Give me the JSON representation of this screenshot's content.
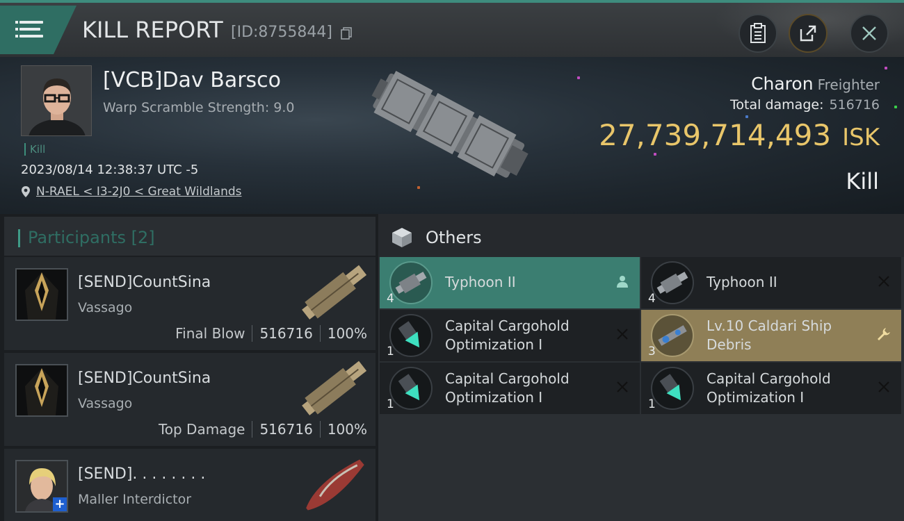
{
  "header": {
    "title": "KILL REPORT",
    "report_id": "[ID:8755844]"
  },
  "victim": {
    "name": "[VCB]Dav Barsco",
    "warp_scramble": "Warp Scramble Strength: 9.0",
    "tag": "Kill",
    "timestamp": "2023/08/14 12:38:37 UTC -5",
    "location": "N-RAEL < I3-2J0 < Great Wildlands",
    "ship_name": "Charon",
    "ship_class": "Freighter",
    "total_damage_label": "Total damage:",
    "total_damage_value": "516716",
    "isk_value": "27,739,714,493",
    "isk_unit": "ISK",
    "result": "Kill"
  },
  "participants": {
    "header": "Participants [2]",
    "rows": [
      {
        "name": "[SEND]CountSina",
        "ship": "Vassago",
        "role": "Final Blow",
        "damage": "516716",
        "percent": "100%"
      },
      {
        "name": "[SEND]CountSina",
        "ship": "Vassago",
        "role": "Top Damage",
        "damage": "516716",
        "percent": "100%"
      },
      {
        "name": "[SEND]. . . . . . . .",
        "ship": "Maller Interdictor"
      }
    ]
  },
  "others": {
    "header": "Others",
    "items": [
      {
        "label": "Typhoon II",
        "qty": "4",
        "state": "selected",
        "mark": "person-icon"
      },
      {
        "label": "Typhoon II",
        "qty": "4",
        "state": "destroyed",
        "mark": "x-icon"
      },
      {
        "label": "Capital Cargohold Optimization I",
        "qty": "1",
        "state": "destroyed",
        "mark": "x-icon"
      },
      {
        "label": "Lv.10 Caldari Ship Debris",
        "qty": "3",
        "state": "dropped",
        "mark": "wrench-icon"
      },
      {
        "label": "Capital Cargohold Optimization I",
        "qty": "1",
        "state": "destroyed",
        "mark": "x-icon"
      },
      {
        "label": "Capital Cargohold Optimization I",
        "qty": "1",
        "state": "destroyed",
        "mark": "x-icon"
      }
    ]
  },
  "colors": {
    "accent_teal": "#3b7e71",
    "isk_gold": "#e9c66a",
    "dropped_gold": "#8f7f57"
  }
}
